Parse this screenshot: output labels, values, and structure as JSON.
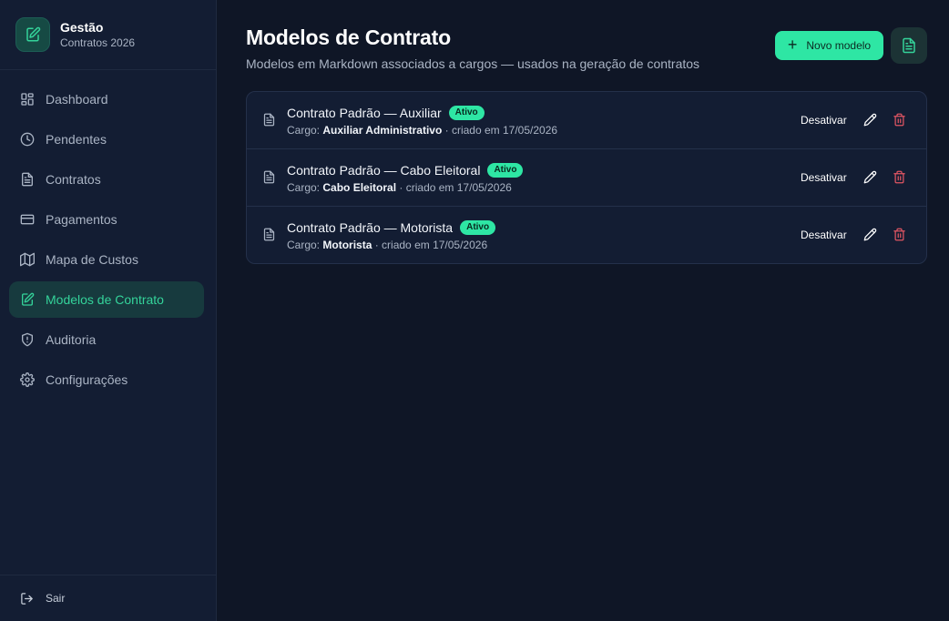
{
  "brand": {
    "title": "Gestão",
    "subtitle": "Contratos 2026"
  },
  "nav": [
    {
      "label": "Dashboard",
      "icon": "grid-icon"
    },
    {
      "label": "Pendentes",
      "icon": "clock-icon"
    },
    {
      "label": "Contratos",
      "icon": "file-icon"
    },
    {
      "label": "Pagamentos",
      "icon": "credit-card-icon"
    },
    {
      "label": "Mapa de Custos",
      "icon": "map-icon"
    },
    {
      "label": "Modelos de Contrato",
      "icon": "file-edit-icon",
      "active": true
    },
    {
      "label": "Auditoria",
      "icon": "shield-alert-icon"
    },
    {
      "label": "Configurações",
      "icon": "gear-icon"
    }
  ],
  "footer": {
    "logout_label": "Sair"
  },
  "header": {
    "title": "Modelos de Contrato",
    "subtitle": "Modelos em Markdown associados a cargos — usados na geração de contratos",
    "new_button": "Novo modelo"
  },
  "templates": [
    {
      "title": "Contrato Padrão — Auxiliar",
      "status": "Ativo",
      "cargo_label": "Cargo:",
      "cargo": "Auxiliar Administrativo",
      "created": "· criado em 17/05/2026",
      "action": "Desativar"
    },
    {
      "title": "Contrato Padrão — Cabo Eleitoral",
      "status": "Ativo",
      "cargo_label": "Cargo:",
      "cargo": "Cabo Eleitoral",
      "created": "· criado em 17/05/2026",
      "action": "Desativar"
    },
    {
      "title": "Contrato Padrão — Motorista",
      "status": "Ativo",
      "cargo_label": "Cargo:",
      "cargo": "Motorista",
      "created": "· criado em 17/05/2026",
      "action": "Desativar"
    }
  ],
  "colors": {
    "accent": "#2ee6a4",
    "active_nav_text": "#34d39a",
    "danger": "#e05563",
    "background": "#0f1626",
    "sidebar": "#131d33"
  }
}
